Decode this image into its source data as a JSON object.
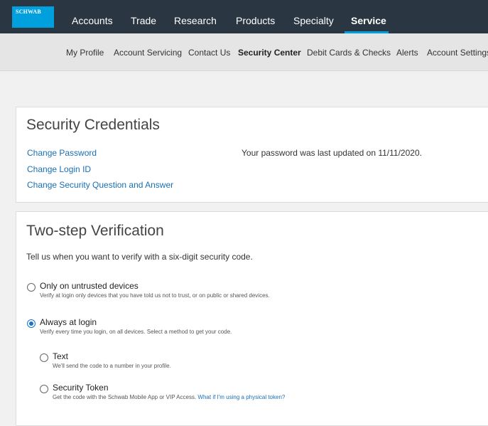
{
  "brand": {
    "logo_text": "SCHWAB",
    "accent": "#00a0df",
    "nav_bg": "#2a3742",
    "link_color": "#1a6fb5"
  },
  "topnav": {
    "items": [
      {
        "label": "Accounts"
      },
      {
        "label": "Trade"
      },
      {
        "label": "Research"
      },
      {
        "label": "Products"
      },
      {
        "label": "Specialty"
      },
      {
        "label": "Service",
        "active": true
      }
    ]
  },
  "subnav": {
    "items": [
      {
        "label": "My Profile"
      },
      {
        "label": "Account Servicing"
      },
      {
        "label": "Contact Us"
      },
      {
        "label": "Security Center",
        "active": true
      },
      {
        "label": "Debit Cards & Checks"
      },
      {
        "label": "Alerts"
      },
      {
        "label": "Account Settings"
      }
    ]
  },
  "credentials": {
    "title": "Security Credentials",
    "links": [
      "Change Password",
      "Change Login ID",
      "Change Security Question and Answer"
    ],
    "password_info": "Your password was last updated on 11/11/2020."
  },
  "two_step": {
    "title": "Two-step Verification",
    "prompt": "Tell us when you want to verify with a six-digit security code.",
    "options": [
      {
        "title": "Only on untrusted devices",
        "desc": "Verify at login only devices that you have told us not to trust, or on public or shared devices.",
        "selected": false
      },
      {
        "title": "Always at login",
        "desc": "Verify every time you login, on all devices. Select a method to get your code.",
        "selected": true
      }
    ],
    "methods": [
      {
        "title": "Text",
        "desc": "We'll send the code to a number in your profile.",
        "selected": false
      },
      {
        "title": "Security Token",
        "desc": "Get the code with the Schwab Mobile App or VIP Access.",
        "link": "What if I'm using a physical token?",
        "selected": false
      }
    ]
  }
}
